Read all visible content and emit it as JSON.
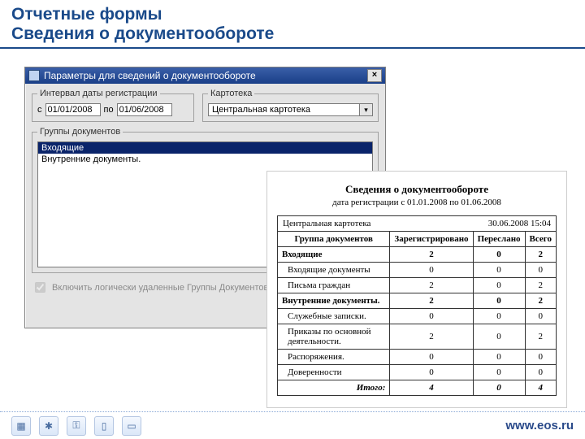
{
  "header": {
    "line1": "Отчетные формы",
    "line2": "Сведения о документообороте"
  },
  "dialog": {
    "title": "Параметры для сведений о документообороте",
    "interval_legend": "Интервал даты регистрации",
    "from_label": "с",
    "from_value": "01/01/2008",
    "to_label": "по",
    "to_value": "01/06/2008",
    "cardfile_legend": "Картотека",
    "cardfile_value": "Центральная картотека",
    "groups_legend": "Группы документов",
    "groups": [
      "Входящие",
      "Внутренние документы."
    ],
    "selected_group_index": 0,
    "checkbox_label": "Включить логически удаленные Группы Документов"
  },
  "report": {
    "title": "Сведения о документообороте",
    "subtitle": "дата регистрации с 01.01.2008 по 01.06.2008",
    "cardfile": "Центральная картотека",
    "timestamp": "30.06.2008 15:04",
    "columns": [
      "Группа документов",
      "Зарегистрировано",
      "Переслано",
      "Всего"
    ],
    "rows": [
      {
        "name": "Входящие",
        "vals": [
          "2",
          "0",
          "2"
        ],
        "bold": true
      },
      {
        "name": "Входящие документы",
        "vals": [
          "0",
          "0",
          "0"
        ],
        "indent": true
      },
      {
        "name": "Письма граждан",
        "vals": [
          "2",
          "0",
          "2"
        ],
        "indent": true
      },
      {
        "name": "Внутренние документы.",
        "vals": [
          "2",
          "0",
          "2"
        ],
        "bold": true
      },
      {
        "name": "Служебные записки.",
        "vals": [
          "0",
          "0",
          "0"
        ],
        "indent": true
      },
      {
        "name": "Приказы по основной деятельности.",
        "vals": [
          "2",
          "0",
          "2"
        ],
        "indent": true
      },
      {
        "name": "Распоряжения.",
        "vals": [
          "0",
          "0",
          "0"
        ],
        "indent": true
      },
      {
        "name": "Доверенности",
        "vals": [
          "0",
          "0",
          "0"
        ],
        "indent": true
      }
    ],
    "total_label": "Итого:",
    "totals": [
      "4",
      "0",
      "4"
    ]
  },
  "footer": {
    "url": "www.eos.ru"
  },
  "chart_data": {
    "type": "table",
    "title": "Сведения о документообороте",
    "columns": [
      "Группа документов",
      "Зарегистрировано",
      "Переслано",
      "Всего"
    ],
    "rows": [
      [
        "Входящие",
        2,
        0,
        2
      ],
      [
        "Входящие документы",
        0,
        0,
        0
      ],
      [
        "Письма граждан",
        2,
        0,
        2
      ],
      [
        "Внутренние документы.",
        2,
        0,
        2
      ],
      [
        "Служебные записки.",
        0,
        0,
        0
      ],
      [
        "Приказы по основной деятельности.",
        2,
        0,
        2
      ],
      [
        "Распоряжения.",
        0,
        0,
        0
      ],
      [
        "Доверенности",
        0,
        0,
        0
      ],
      [
        "Итого:",
        4,
        0,
        4
      ]
    ]
  }
}
